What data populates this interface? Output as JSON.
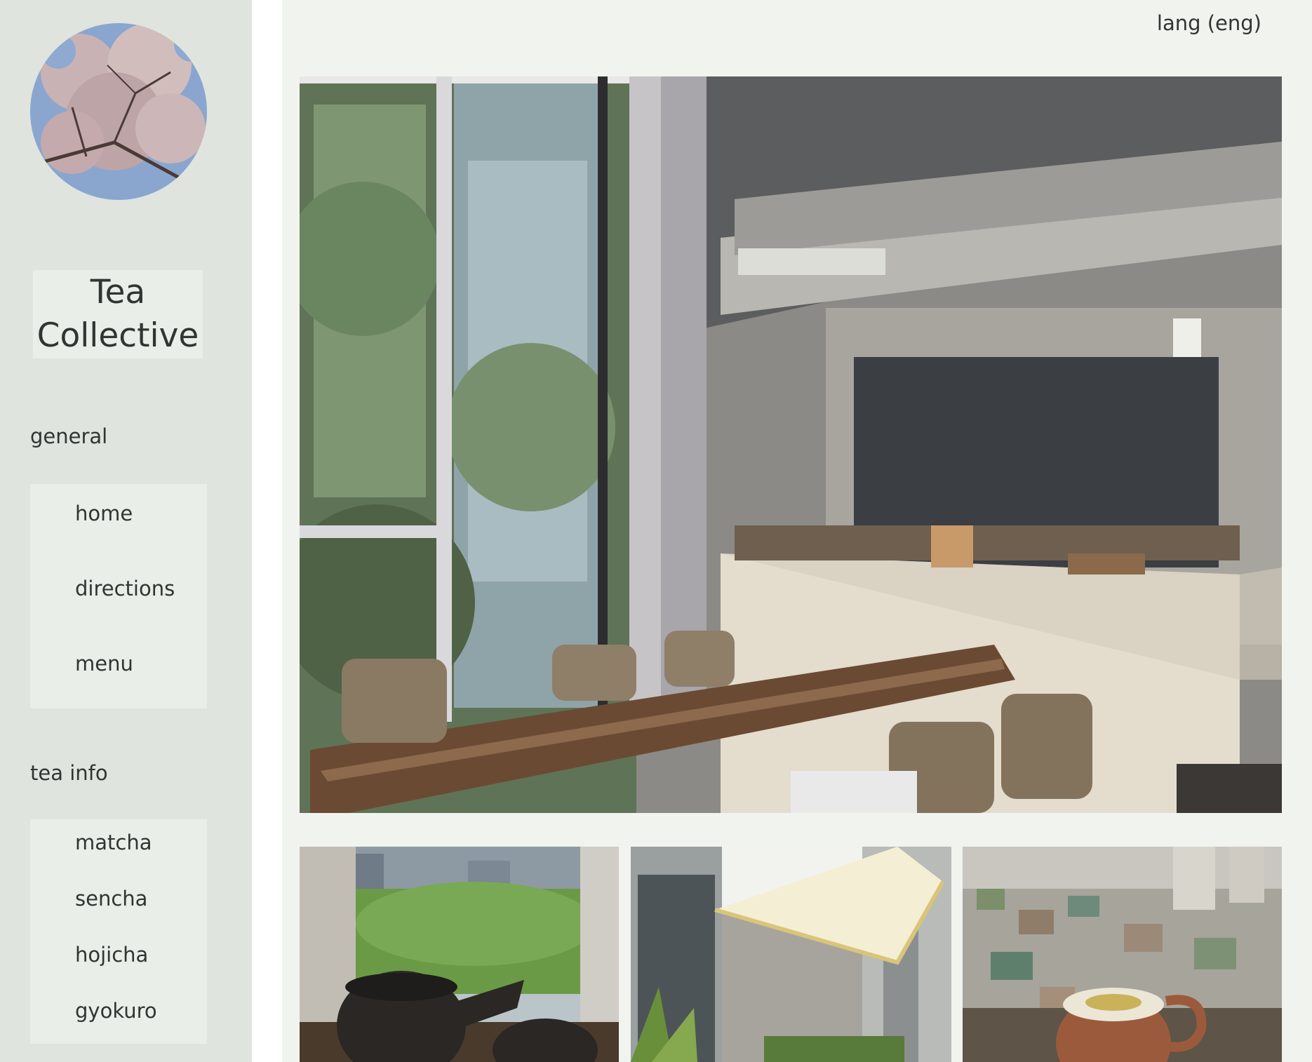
{
  "brand": {
    "name_line1": "Tea",
    "name_line2": "Collective"
  },
  "header": {
    "lang_label": "lang (eng)"
  },
  "nav": {
    "general": {
      "title": "general",
      "items": [
        "home",
        "directions",
        "menu"
      ]
    },
    "tea_info": {
      "title": "tea info",
      "items": [
        "matcha",
        "sencha",
        "hojicha",
        "gyokuro"
      ]
    }
  },
  "colors": {
    "sidebar_bg": "#dfe4de",
    "panel_bg": "#e9eee8",
    "main_bg": "#f1f3ef",
    "text": "#2f3530"
  }
}
